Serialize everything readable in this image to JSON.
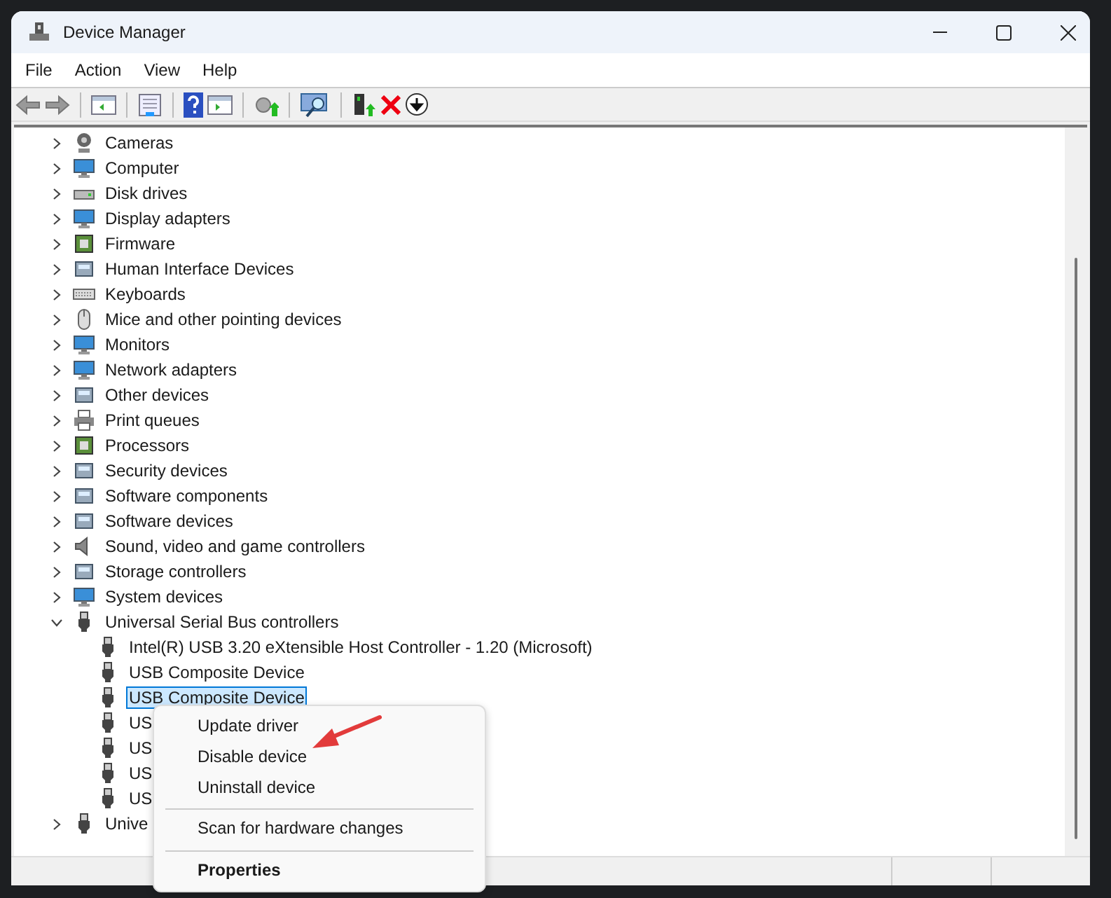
{
  "window": {
    "title": "Device Manager"
  },
  "menu_bar": [
    "File",
    "Action",
    "View",
    "Help"
  ],
  "tree": [
    {
      "label": "Cameras",
      "expanded": false,
      "selected": false
    },
    {
      "label": "Computer",
      "expanded": false,
      "selected": false
    },
    {
      "label": "Disk drives",
      "expanded": false,
      "selected": false
    },
    {
      "label": "Display adapters",
      "expanded": false,
      "selected": false
    },
    {
      "label": "Firmware",
      "expanded": false,
      "selected": false
    },
    {
      "label": "Human Interface Devices",
      "expanded": false,
      "selected": false
    },
    {
      "label": "Keyboards",
      "expanded": false,
      "selected": false
    },
    {
      "label": "Mice and other pointing devices",
      "expanded": false,
      "selected": false
    },
    {
      "label": "Monitors",
      "expanded": false,
      "selected": false
    },
    {
      "label": "Network adapters",
      "expanded": false,
      "selected": false
    },
    {
      "label": "Other devices",
      "expanded": false,
      "selected": false
    },
    {
      "label": "Print queues",
      "expanded": false,
      "selected": false
    },
    {
      "label": "Processors",
      "expanded": false,
      "selected": false
    },
    {
      "label": "Security devices",
      "expanded": false,
      "selected": false
    },
    {
      "label": "Software components",
      "expanded": false,
      "selected": false
    },
    {
      "label": "Software devices",
      "expanded": false,
      "selected": false
    },
    {
      "label": "Sound, video and game controllers",
      "expanded": false,
      "selected": false
    },
    {
      "label": "Storage controllers",
      "expanded": false,
      "selected": false
    },
    {
      "label": "System devices",
      "expanded": false,
      "selected": false
    },
    {
      "label": "Universal Serial Bus controllers",
      "expanded": true,
      "selected": false,
      "children": [
        {
          "label": "Intel(R) USB 3.20 eXtensible Host Controller - 1.20 (Microsoft)",
          "selected": false
        },
        {
          "label": "USB Composite Device",
          "selected": false
        },
        {
          "label": "USB Composite Device",
          "selected": true
        },
        {
          "label": "US",
          "selected": false
        },
        {
          "label": "US",
          "selected": false
        },
        {
          "label": "US",
          "selected": false
        },
        {
          "label": "US",
          "selected": false
        }
      ]
    },
    {
      "label": "Unive",
      "expanded": false,
      "selected": false
    }
  ],
  "context_menu": {
    "items": [
      {
        "label": "Update driver",
        "default": false,
        "separator_before": false
      },
      {
        "label": "Disable device",
        "default": false,
        "separator_before": false
      },
      {
        "label": "Uninstall device",
        "default": false,
        "separator_before": false
      },
      {
        "label": "Scan for hardware changes",
        "default": false,
        "separator_before": true
      },
      {
        "label": "Properties",
        "default": true,
        "separator_before": true
      }
    ]
  }
}
